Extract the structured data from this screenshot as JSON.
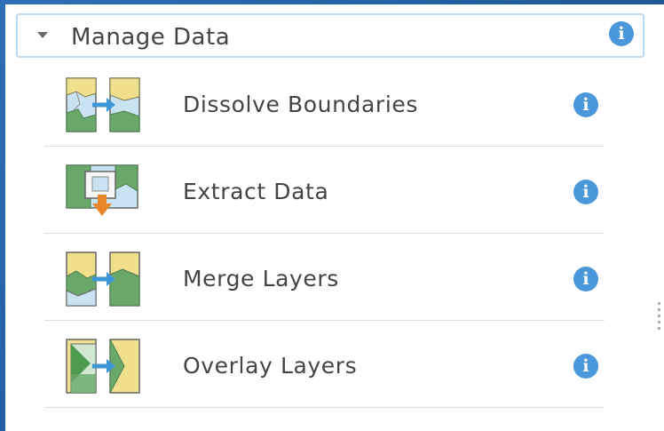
{
  "panel": {
    "title": "Manage Data",
    "info_glyph": "i"
  },
  "tools": [
    {
      "label": "Dissolve Boundaries",
      "icon": "dissolve-boundaries-icon"
    },
    {
      "label": "Extract Data",
      "icon": "extract-data-icon"
    },
    {
      "label": "Merge Layers",
      "icon": "merge-layers-icon"
    },
    {
      "label": "Overlay Layers",
      "icon": "overlay-layers-icon"
    }
  ],
  "colors": {
    "accent": "#4a98d9",
    "map_yellow": "#f0e08e",
    "map_green": "#6aa86a",
    "map_blue": "#c9e3f3",
    "arrow_blue": "#3f97d6",
    "arrow_orange": "#e8862a"
  }
}
